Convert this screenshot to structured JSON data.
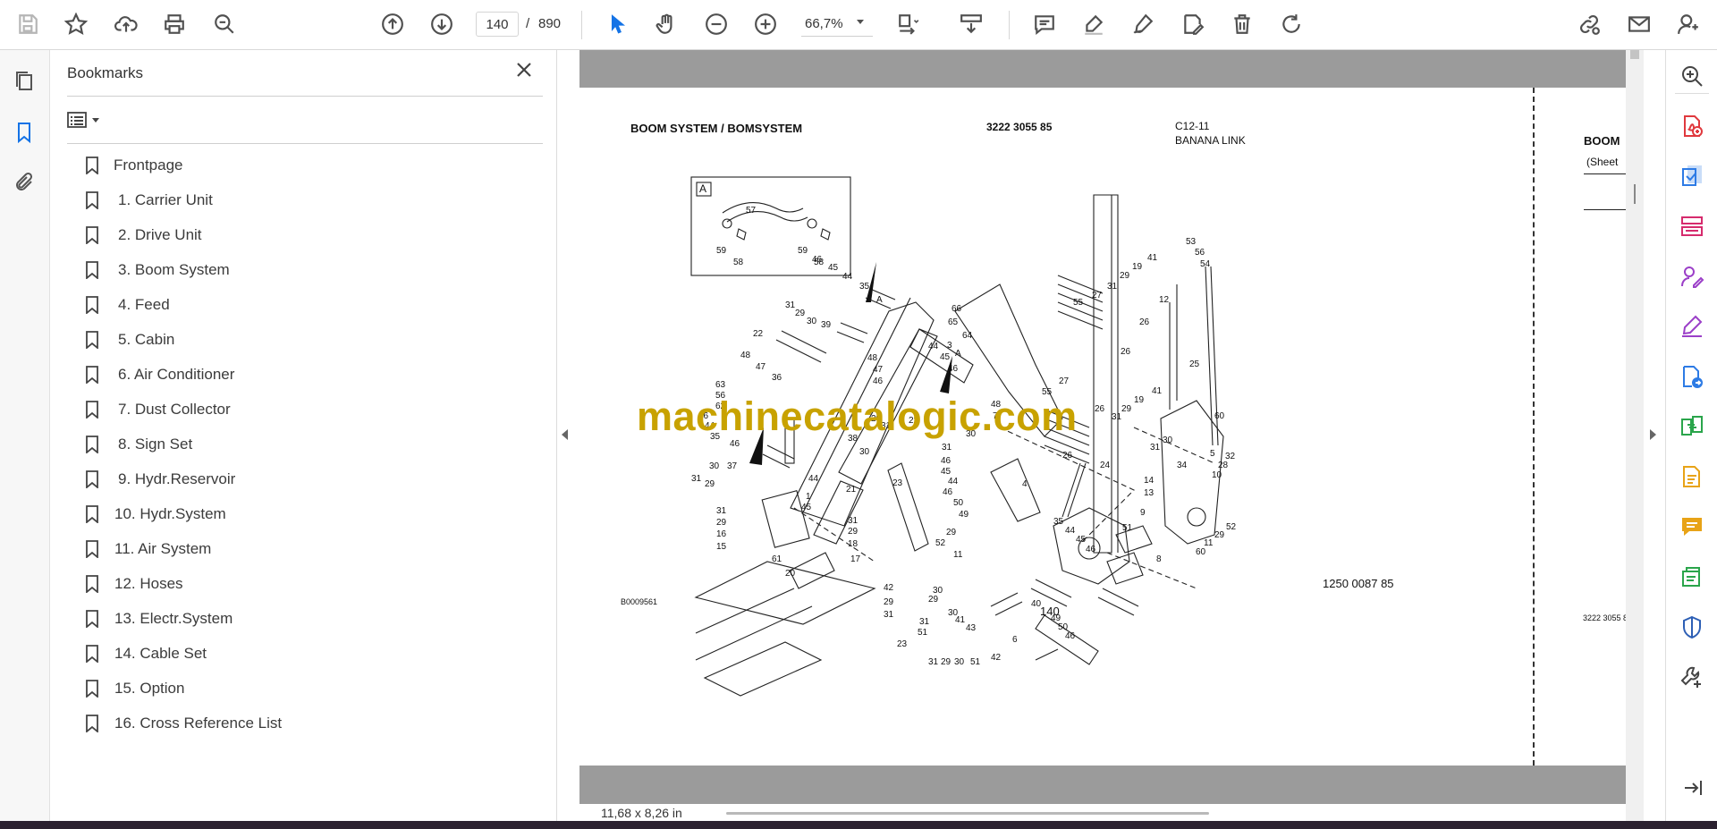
{
  "toolbar": {
    "current_page": "140",
    "page_separator": "/",
    "total_pages": "890",
    "zoom": "66,7%"
  },
  "bookmarks": {
    "title": "Bookmarks",
    "items": [
      {
        "label": "Frontpage"
      },
      {
        "label": "1. Carrier Unit"
      },
      {
        "label": "2. Drive Unit"
      },
      {
        "label": "3. Boom System"
      },
      {
        "label": "4. Feed"
      },
      {
        "label": "5. Cabin"
      },
      {
        "label": "6. Air Conditioner"
      },
      {
        "label": "7. Dust Collector"
      },
      {
        "label": "8. Sign Set"
      },
      {
        "label": "9. Hydr.Reservoir"
      },
      {
        "label": "10. Hydr.System"
      },
      {
        "label": "11. Air System"
      },
      {
        "label": "12. Hoses"
      },
      {
        "label": "13. Electr.System"
      },
      {
        "label": "14. Cable Set"
      },
      {
        "label": "15. Option"
      },
      {
        "label": "16. Cross Reference List"
      }
    ]
  },
  "document": {
    "header_title": "BOOM SYSTEM / BOMSYSTEM",
    "header_partno": "3222 3055 85",
    "header_code": "C12-11",
    "header_sub": "BANANA LINK",
    "detail_label": "A",
    "drawing_no": "B0009561",
    "assembly_no": "1250 0087 85",
    "page_number": "140",
    "watermark": "machinecatalogic.com",
    "next_page_title": "BOOM",
    "next_page_sheet": "(Sheet",
    "next_page_partno": "3222 3055 8",
    "page_size": "11,68 x 8,26 in"
  },
  "icons": {
    "toolbar": [
      "save-icon",
      "bookmark-star-icon",
      "upload-icon",
      "print-icon",
      "zoom-search-icon",
      "page-up-icon",
      "page-down-icon",
      "select-cursor-icon",
      "hand-icon",
      "zoom-out-icon",
      "zoom-in-icon",
      "fit-page-icon",
      "scroll-mode-icon",
      "comment-icon",
      "highlight-icon",
      "sign-icon",
      "edit-text-icon",
      "delete-icon",
      "rotate-icon",
      "share-link-icon",
      "email-icon",
      "account-icon"
    ],
    "left_rail": [
      "page-thumbnails-icon",
      "bookmarks-icon",
      "attachments-icon"
    ],
    "right_rail": [
      "zoom-tool-icon",
      "export-pdf-icon",
      "create-pdf-icon",
      "organize-pages-icon",
      "request-signature-icon",
      "fill-sign-icon",
      "convert-pdf-icon",
      "compare-icon",
      "edit-pdf-icon",
      "comment-tool-icon",
      "protect-icon",
      "shield-icon",
      "more-tools-icon",
      "collapse-pane-icon"
    ]
  },
  "colors": {
    "accent": "#1473e6",
    "watermark": "#c8a200",
    "gutter_gray": "#9b9b9b"
  }
}
